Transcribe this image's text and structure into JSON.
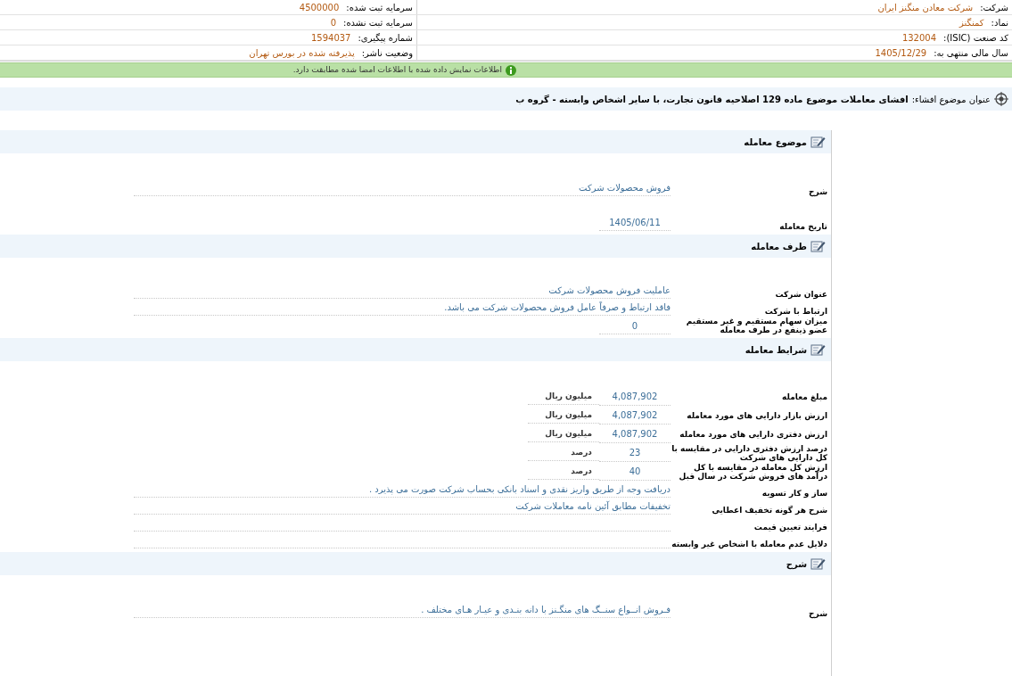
{
  "company_info": [
    [
      {
        "label": "شرکت:",
        "value": "شرکت معادن منگنز ایران"
      },
      {
        "label": "سرمایه ثبت شده:",
        "value": "4500000"
      }
    ],
    [
      {
        "label": "نماد:",
        "value": "کمنگنز"
      },
      {
        "label": "سرمایه ثبت نشده:",
        "value": "0"
      }
    ],
    [
      {
        "label": "کد صنعت (ISIC):",
        "value": "132004"
      },
      {
        "label": "شماره پیگیری:",
        "value": "1594037"
      }
    ],
    [
      {
        "label": "سال مالی منتهی به:",
        "value": "1405/12/29"
      },
      {
        "label": "وضعیت ناشر:",
        "value": "پذیرفته شده در بورس تهران"
      }
    ]
  ],
  "notice": "اطلاعات نمایش داده شده با اطلاعات امضا شده مطابقت دارد.",
  "subject": {
    "label": "عنوان موضوع افشاء:",
    "value": "افشای معاملات موضوع ماده 129 اصلاحیه قانون تجارت، با سایر اشخاص وابسته - گروه ب"
  },
  "sections": [
    {
      "title": "موضوع معامله",
      "fields": [
        {
          "kind": "wide",
          "label": "شرح",
          "value": "فروش محصولات شرکت"
        },
        {
          "kind": "short",
          "label": "تاریخ معامله",
          "value": "1405/06/11"
        }
      ]
    },
    {
      "title": "طرف معامله",
      "fields": [
        {
          "kind": "wide",
          "label": "عنوان شرکت",
          "value": "عاملیت فروش محصولات شرکت"
        },
        {
          "kind": "wide",
          "label": "ارتباط با شرکت",
          "value": "فاقد ارتباط و صرفاً عامل فروش محصولات شرکت می باشد."
        },
        {
          "kind": "short",
          "label": "میزان سهام مستقیم و غیر مستقیم عضو ذینفع در طرف معامله",
          "value": "0"
        }
      ]
    },
    {
      "title": "شرایط معامله",
      "fields": [
        {
          "kind": "amount",
          "label": "مبلغ معامله",
          "value": "4,087,902",
          "unit": "میلیون ریال"
        },
        {
          "kind": "amount",
          "label": "ارزش بازار دارایی های مورد معامله",
          "value": "4,087,902",
          "unit": "میلیون ریال"
        },
        {
          "kind": "amount",
          "label": "ارزش دفتری دارایی های مورد معامله",
          "value": "4,087,902",
          "unit": "میلیون ریال"
        },
        {
          "kind": "amount",
          "label": "درصد ارزش دفتری دارایی در مقایسه با کل دارایی های شرکت",
          "value": "23",
          "unit": "درصد"
        },
        {
          "kind": "amount",
          "label": "ارزش کل معامله در مقایسه با کل درآمد های فروش شرکت در سال قبل",
          "value": "40",
          "unit": "درصد"
        },
        {
          "kind": "wide",
          "label": "ساز و کار تسویه",
          "value": "دریافت وجه از طریق واریز نقدی و اسناد بانکی بحساب شرکت صورت می پذیرد ."
        },
        {
          "kind": "wide",
          "label": "شرح هر گونه تخفیف اعطایی",
          "value": "تخفیفات مطابق آئین نامه معاملات شرکت"
        },
        {
          "kind": "wide",
          "label": "فرایند تعیین قیمت"
        },
        {
          "kind": "wide",
          "label": "دلایل عدم معامله با اشخاص غیر وابسته"
        }
      ]
    },
    {
      "title": "شرح",
      "fields": [
        {
          "kind": "wide",
          "label": "شرح",
          "value": "فـروش انــواع سنــگ های منگـنز با دانه بنـدی و عیـار هـای مختلف ."
        }
      ]
    }
  ]
}
